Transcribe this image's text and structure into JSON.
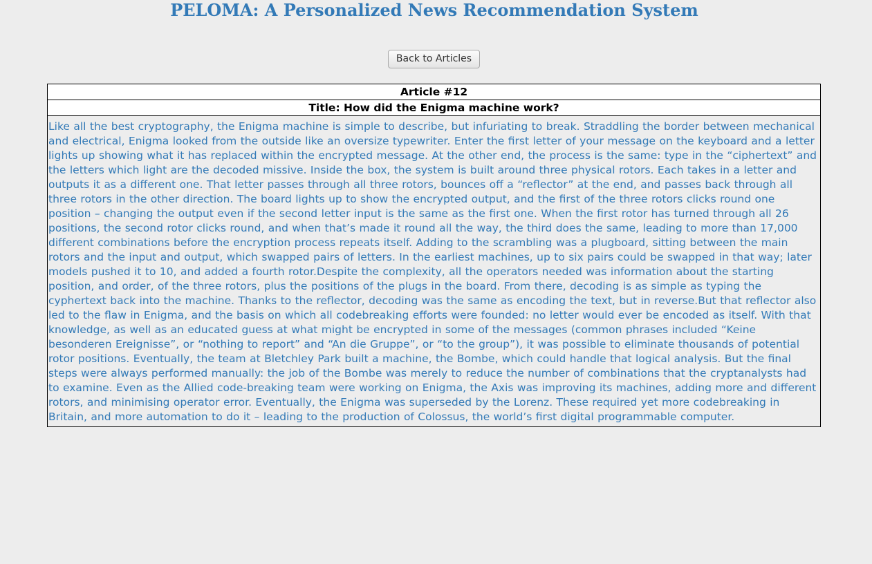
{
  "header": {
    "title": "PELOMA: A Personalized News Recommendation System"
  },
  "nav": {
    "back_label": "Back to Articles"
  },
  "article": {
    "number_label": "Article #12",
    "title_label": "Title: How did the Enigma machine work?",
    "body": "Like all the best cryptography, the Enigma machine is simple to describe, but infuriating to break. Straddling the border between mechanical and electrical, Enigma looked from the outside like an oversize typewriter. Enter the first letter of your message on the keyboard and a letter lights up showing what it has replaced within the encrypted message. At the other end, the process is the same: type in the “ciphertext” and the letters which light are the decoded missive. Inside the box, the system is built around three physical rotors. Each takes in a letter and outputs it as a different one. That letter passes through all three rotors, bounces off a “reflector” at the end, and passes back through all three rotors in the other direction. The board lights up to show the encrypted output, and the first of the three rotors clicks round one position – changing the output even if the second letter input is the same as the first one. When the first rotor has turned through all 26 positions, the second rotor clicks round, and when that’s made it round all the way, the third does the same, leading to more than 17,000 different combinations before the encryption process repeats itself. Adding to the scrambling was a plugboard, sitting between the main rotors and the input and output, which swapped pairs of letters. In the earliest machines, up to six pairs could be swapped in that way; later models pushed it to 10, and added a fourth rotor.Despite the complexity, all the operators needed was information about the starting position, and order, of the three rotors, plus the positions of the plugs in the board. From there, decoding is as simple as typing the cyphertext back into the machine. Thanks to the reflector, decoding was the same as encoding the text, but in reverse.But that reflector also led to the flaw in Enigma, and the basis on which all codebreaking efforts were founded: no letter would ever be encoded as itself. With that knowledge, as well as an educated guess at what might be encrypted in some of the messages (common phrases included “Keine besonderen Ereignisse”, or “nothing to report” and “An die Gruppe”, or “to the group”), it was possible to eliminate thousands of potential rotor positions. Eventually, the team at Bletchley Park built a machine, the Bombe, which could handle that logical analysis. But the final steps were always performed manually: the job of the Bombe was merely to reduce the number of combinations that the cryptanalysts had to examine. Even as the Allied code-breaking team were working on Enigma, the Axis was improving its machines, adding more and different rotors, and minimising operator error. Eventually, the Enigma was superseded by the Lorenz. These required yet more codebreaking in Britain, and more automation to do it – leading to the production of Colossus, the world’s first digital programmable computer."
  },
  "colors": {
    "accent": "#337ab7",
    "background": "#ededed",
    "border": "#000000"
  }
}
